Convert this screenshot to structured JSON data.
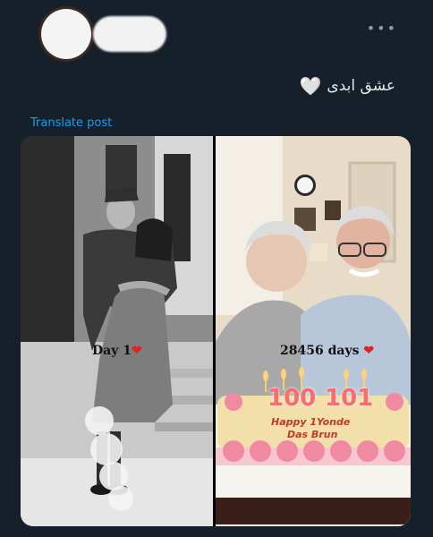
{
  "post": {
    "more_label": "•••",
    "text": "عشق ابدی",
    "heart": "🤍",
    "translate_label": "Translate post"
  },
  "media": {
    "left_caption": "Day 1",
    "left_heart": "❤",
    "right_caption": "28456 days",
    "right_heart": "❤",
    "candles_left": "100",
    "candles_right": "101",
    "cake_line1": "Happy 1Yonde",
    "cake_line2": "Das Brun"
  },
  "colors": {
    "background": "#15202b",
    "link": "#1d9bf0"
  }
}
